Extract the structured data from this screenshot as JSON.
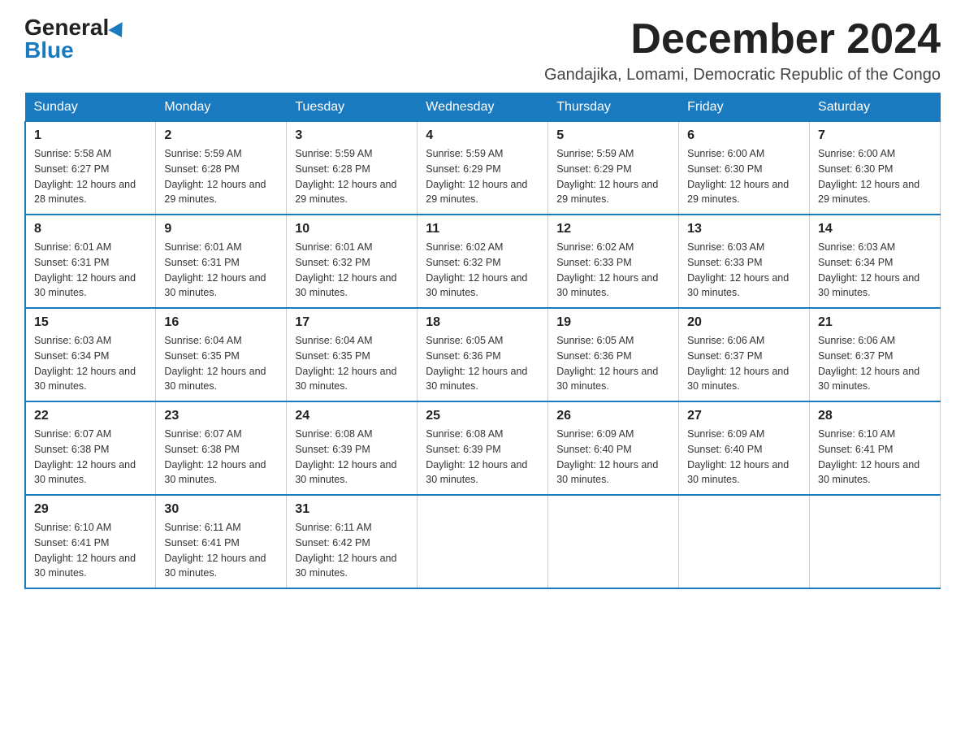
{
  "header": {
    "logo_general": "General",
    "logo_blue": "Blue",
    "month_year": "December 2024",
    "location": "Gandajika, Lomami, Democratic Republic of the Congo"
  },
  "days_of_week": [
    "Sunday",
    "Monday",
    "Tuesday",
    "Wednesday",
    "Thursday",
    "Friday",
    "Saturday"
  ],
  "weeks": [
    [
      {
        "day": "1",
        "sunrise": "5:58 AM",
        "sunset": "6:27 PM",
        "daylight": "12 hours and 28 minutes."
      },
      {
        "day": "2",
        "sunrise": "5:59 AM",
        "sunset": "6:28 PM",
        "daylight": "12 hours and 29 minutes."
      },
      {
        "day": "3",
        "sunrise": "5:59 AM",
        "sunset": "6:28 PM",
        "daylight": "12 hours and 29 minutes."
      },
      {
        "day": "4",
        "sunrise": "5:59 AM",
        "sunset": "6:29 PM",
        "daylight": "12 hours and 29 minutes."
      },
      {
        "day": "5",
        "sunrise": "5:59 AM",
        "sunset": "6:29 PM",
        "daylight": "12 hours and 29 minutes."
      },
      {
        "day": "6",
        "sunrise": "6:00 AM",
        "sunset": "6:30 PM",
        "daylight": "12 hours and 29 minutes."
      },
      {
        "day": "7",
        "sunrise": "6:00 AM",
        "sunset": "6:30 PM",
        "daylight": "12 hours and 29 minutes."
      }
    ],
    [
      {
        "day": "8",
        "sunrise": "6:01 AM",
        "sunset": "6:31 PM",
        "daylight": "12 hours and 30 minutes."
      },
      {
        "day": "9",
        "sunrise": "6:01 AM",
        "sunset": "6:31 PM",
        "daylight": "12 hours and 30 minutes."
      },
      {
        "day": "10",
        "sunrise": "6:01 AM",
        "sunset": "6:32 PM",
        "daylight": "12 hours and 30 minutes."
      },
      {
        "day": "11",
        "sunrise": "6:02 AM",
        "sunset": "6:32 PM",
        "daylight": "12 hours and 30 minutes."
      },
      {
        "day": "12",
        "sunrise": "6:02 AM",
        "sunset": "6:33 PM",
        "daylight": "12 hours and 30 minutes."
      },
      {
        "day": "13",
        "sunrise": "6:03 AM",
        "sunset": "6:33 PM",
        "daylight": "12 hours and 30 minutes."
      },
      {
        "day": "14",
        "sunrise": "6:03 AM",
        "sunset": "6:34 PM",
        "daylight": "12 hours and 30 minutes."
      }
    ],
    [
      {
        "day": "15",
        "sunrise": "6:03 AM",
        "sunset": "6:34 PM",
        "daylight": "12 hours and 30 minutes."
      },
      {
        "day": "16",
        "sunrise": "6:04 AM",
        "sunset": "6:35 PM",
        "daylight": "12 hours and 30 minutes."
      },
      {
        "day": "17",
        "sunrise": "6:04 AM",
        "sunset": "6:35 PM",
        "daylight": "12 hours and 30 minutes."
      },
      {
        "day": "18",
        "sunrise": "6:05 AM",
        "sunset": "6:36 PM",
        "daylight": "12 hours and 30 minutes."
      },
      {
        "day": "19",
        "sunrise": "6:05 AM",
        "sunset": "6:36 PM",
        "daylight": "12 hours and 30 minutes."
      },
      {
        "day": "20",
        "sunrise": "6:06 AM",
        "sunset": "6:37 PM",
        "daylight": "12 hours and 30 minutes."
      },
      {
        "day": "21",
        "sunrise": "6:06 AM",
        "sunset": "6:37 PM",
        "daylight": "12 hours and 30 minutes."
      }
    ],
    [
      {
        "day": "22",
        "sunrise": "6:07 AM",
        "sunset": "6:38 PM",
        "daylight": "12 hours and 30 minutes."
      },
      {
        "day": "23",
        "sunrise": "6:07 AM",
        "sunset": "6:38 PM",
        "daylight": "12 hours and 30 minutes."
      },
      {
        "day": "24",
        "sunrise": "6:08 AM",
        "sunset": "6:39 PM",
        "daylight": "12 hours and 30 minutes."
      },
      {
        "day": "25",
        "sunrise": "6:08 AM",
        "sunset": "6:39 PM",
        "daylight": "12 hours and 30 minutes."
      },
      {
        "day": "26",
        "sunrise": "6:09 AM",
        "sunset": "6:40 PM",
        "daylight": "12 hours and 30 minutes."
      },
      {
        "day": "27",
        "sunrise": "6:09 AM",
        "sunset": "6:40 PM",
        "daylight": "12 hours and 30 minutes."
      },
      {
        "day": "28",
        "sunrise": "6:10 AM",
        "sunset": "6:41 PM",
        "daylight": "12 hours and 30 minutes."
      }
    ],
    [
      {
        "day": "29",
        "sunrise": "6:10 AM",
        "sunset": "6:41 PM",
        "daylight": "12 hours and 30 minutes."
      },
      {
        "day": "30",
        "sunrise": "6:11 AM",
        "sunset": "6:41 PM",
        "daylight": "12 hours and 30 minutes."
      },
      {
        "day": "31",
        "sunrise": "6:11 AM",
        "sunset": "6:42 PM",
        "daylight": "12 hours and 30 minutes."
      },
      null,
      null,
      null,
      null
    ]
  ],
  "labels": {
    "sunrise": "Sunrise:",
    "sunset": "Sunset:",
    "daylight": "Daylight:"
  }
}
